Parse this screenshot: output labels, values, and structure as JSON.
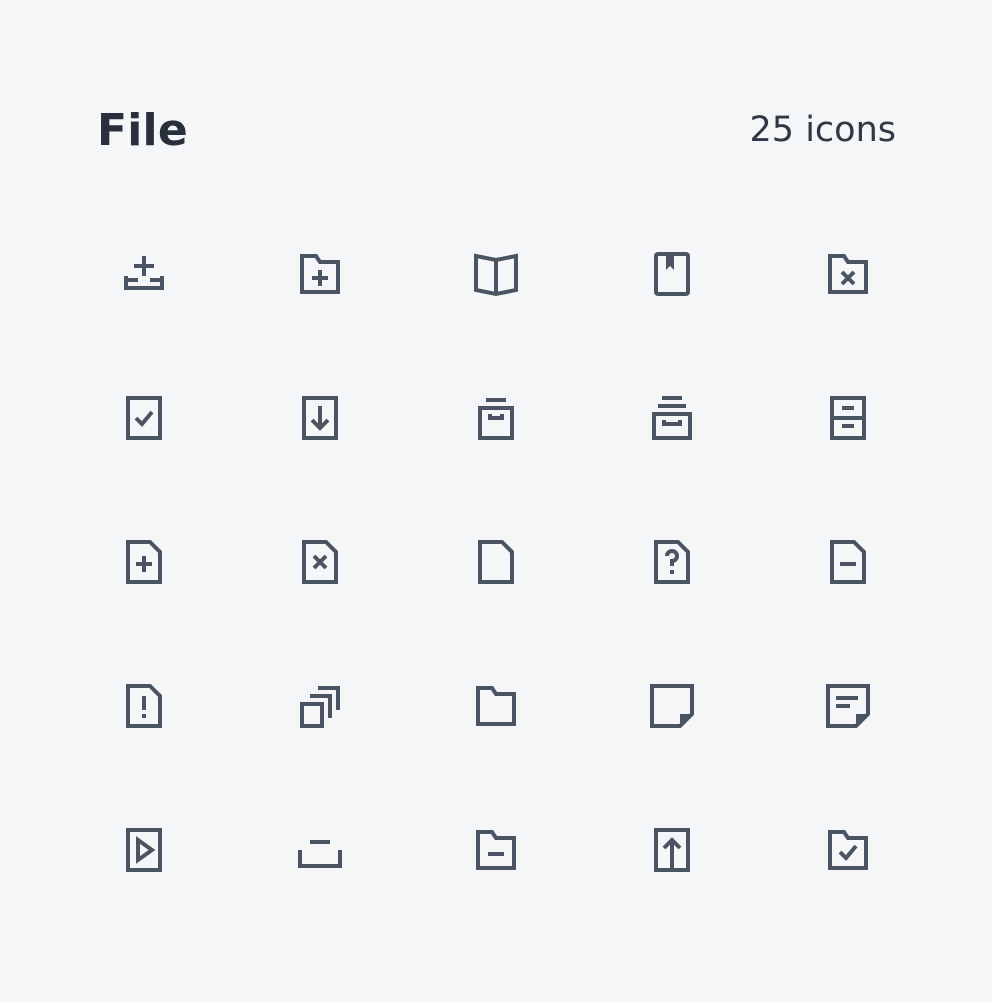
{
  "header": {
    "title": "File",
    "count_label": "25 icons"
  },
  "theme": {
    "background": "#f5f6f8",
    "icon_color": "#4a5462",
    "text_color": "#27303b"
  },
  "icons": [
    "inbox-add-icon",
    "folder-add-icon",
    "open-book-icon",
    "bookmark-book-icon",
    "folder-remove-icon",
    "file-check-icon",
    "file-download-icon",
    "archive-box-icon",
    "archive-stack-icon",
    "file-cabinet-icon",
    "file-add-icon",
    "file-remove-icon",
    "file-blank-icon",
    "file-question-icon",
    "file-minus-icon",
    "file-alert-icon",
    "copy-stack-icon",
    "folder-icon",
    "sticky-note-icon",
    "note-text-icon",
    "file-play-icon",
    "tray-icon",
    "folder-minus-icon",
    "file-upload-icon",
    "folder-check-icon"
  ]
}
